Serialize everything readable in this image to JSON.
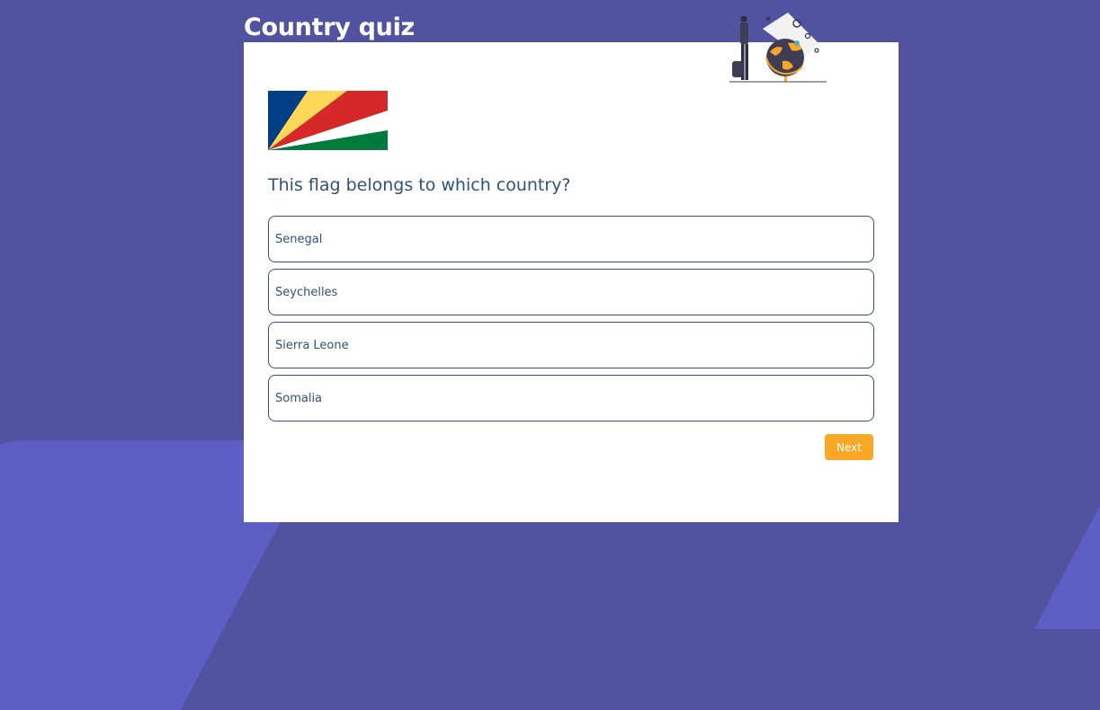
{
  "app": {
    "title": "Country quiz"
  },
  "quiz": {
    "question": "This flag belongs to which country?",
    "flag_icon": "seychelles-flag",
    "options": [
      {
        "label": "Senegal"
      },
      {
        "label": "Seychelles"
      },
      {
        "label": "Sierra Leone"
      },
      {
        "label": "Somalia"
      }
    ],
    "next_label": "Next"
  },
  "colors": {
    "background": "#5153a0",
    "background_shape": "#5d5fc4",
    "card": "#ffffff",
    "text": "#2f527b",
    "accent": "#f9a826"
  }
}
